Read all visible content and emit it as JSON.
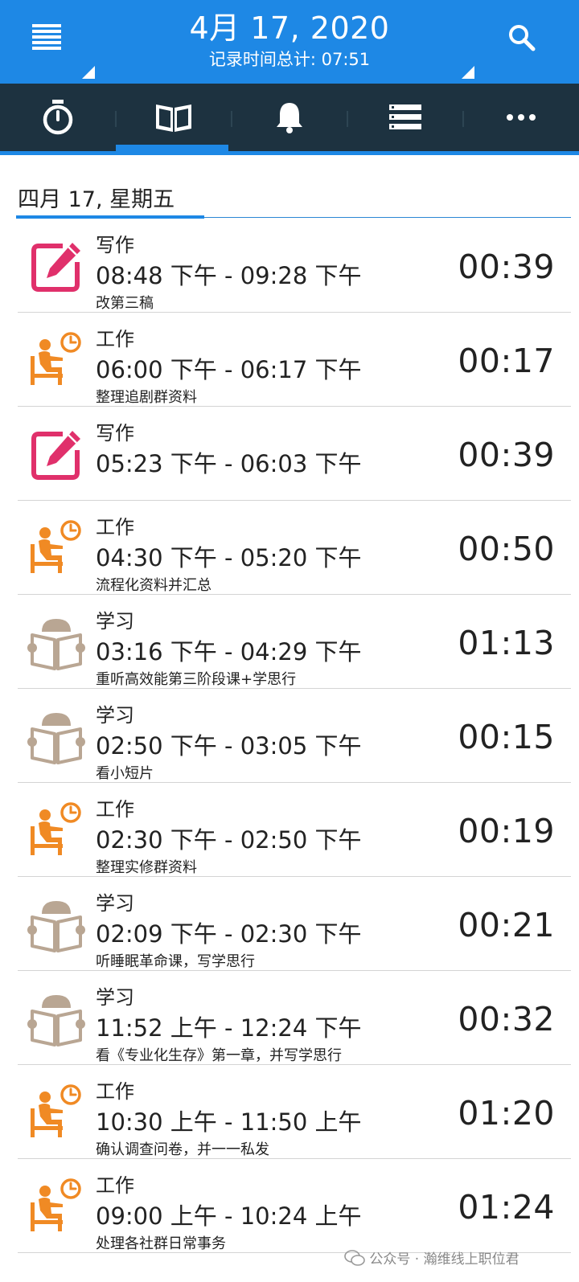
{
  "header": {
    "date_title": "4月 17, 2020",
    "total_label": "记录时间总计: 07:51"
  },
  "tabs": [
    {
      "icon": "stopwatch-icon",
      "active": false
    },
    {
      "icon": "book-icon",
      "active": true
    },
    {
      "icon": "bell-icon",
      "active": false
    },
    {
      "icon": "list-icon",
      "active": false
    },
    {
      "icon": "more-icon",
      "active": false
    }
  ],
  "day_header": "四月 17, 星期五",
  "colors": {
    "primary": "#1e88e5",
    "tabbar": "#1d3240",
    "writing": "#e0306b",
    "work": "#f08a24",
    "study": "#b9a693"
  },
  "entries": [
    {
      "category": "写作",
      "icon": "edit-icon",
      "range": "08:48 下午 - 09:28 下午",
      "note": "改第三稿",
      "duration": "00:39"
    },
    {
      "category": "工作",
      "icon": "work-desk-clock-icon",
      "range": "06:00 下午 - 06:17 下午",
      "note": "整理追剧群资料",
      "duration": "00:17"
    },
    {
      "category": "写作",
      "icon": "edit-icon",
      "range": "05:23 下午 - 06:03 下午",
      "note": "",
      "duration": "00:39"
    },
    {
      "category": "工作",
      "icon": "work-desk-clock-icon",
      "range": "04:30 下午 - 05:20 下午",
      "note": "流程化资料并汇总",
      "duration": "00:50"
    },
    {
      "category": "学习",
      "icon": "reading-icon",
      "range": "03:16 下午 - 04:29 下午",
      "note": "重听高效能第三阶段课+学思行",
      "duration": "01:13"
    },
    {
      "category": "学习",
      "icon": "reading-icon",
      "range": "02:50 下午 - 03:05 下午",
      "note": "看小短片",
      "duration": "00:15"
    },
    {
      "category": "工作",
      "icon": "work-desk-clock-icon",
      "range": "02:30 下午 - 02:50 下午",
      "note": "整理实修群资料",
      "duration": "00:19"
    },
    {
      "category": "学习",
      "icon": "reading-icon",
      "range": "02:09 下午 - 02:30 下午",
      "note": "听睡眠革命课，写学思行",
      "duration": "00:21"
    },
    {
      "category": "学习",
      "icon": "reading-icon",
      "range": "11:52 上午 - 12:24 下午",
      "note": "看《专业化生存》第一章，并写学思行",
      "duration": "00:32"
    },
    {
      "category": "工作",
      "icon": "work-desk-clock-icon",
      "range": "10:30 上午 - 11:50 上午",
      "note": "确认调查问卷，并一一私发",
      "duration": "01:20"
    },
    {
      "category": "工作",
      "icon": "work-desk-clock-icon",
      "range": "09:00 上午 - 10:24 上午",
      "note": "处理各社群日常事务",
      "duration": "01:24"
    }
  ],
  "watermark": "公众号 · 瀚维线上职位君"
}
